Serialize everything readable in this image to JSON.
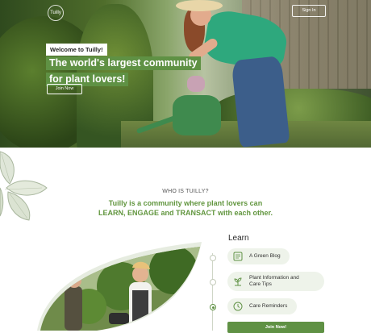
{
  "header": {
    "logo_text": "Tuilly",
    "signin_label": "Sign In"
  },
  "hero": {
    "welcome": "Welcome to Tuilly!",
    "headline_line1": "The world's largest community",
    "headline_line2": "for plant lovers!",
    "join_label": "Join Now"
  },
  "about": {
    "heading": "WHO IS TUILLY?",
    "tagline_line1": "Tuilly is a community where plant lovers can",
    "tagline_line2": "LEARN, ENGAGE and TRANSACT with each other."
  },
  "learn": {
    "title": "Learn",
    "items": [
      {
        "label": "A Green Blog",
        "icon": "book-icon"
      },
      {
        "label_line1": "Plant Information and",
        "label_line2": "Care Tips",
        "icon": "plant-icon"
      },
      {
        "label": "Care Reminders",
        "icon": "reminder-icon"
      }
    ],
    "join_label": "Join Now!"
  },
  "colors": {
    "brand_green": "#5f9144",
    "tagline_green": "#62963f",
    "item_bg": "#eef3ea"
  }
}
